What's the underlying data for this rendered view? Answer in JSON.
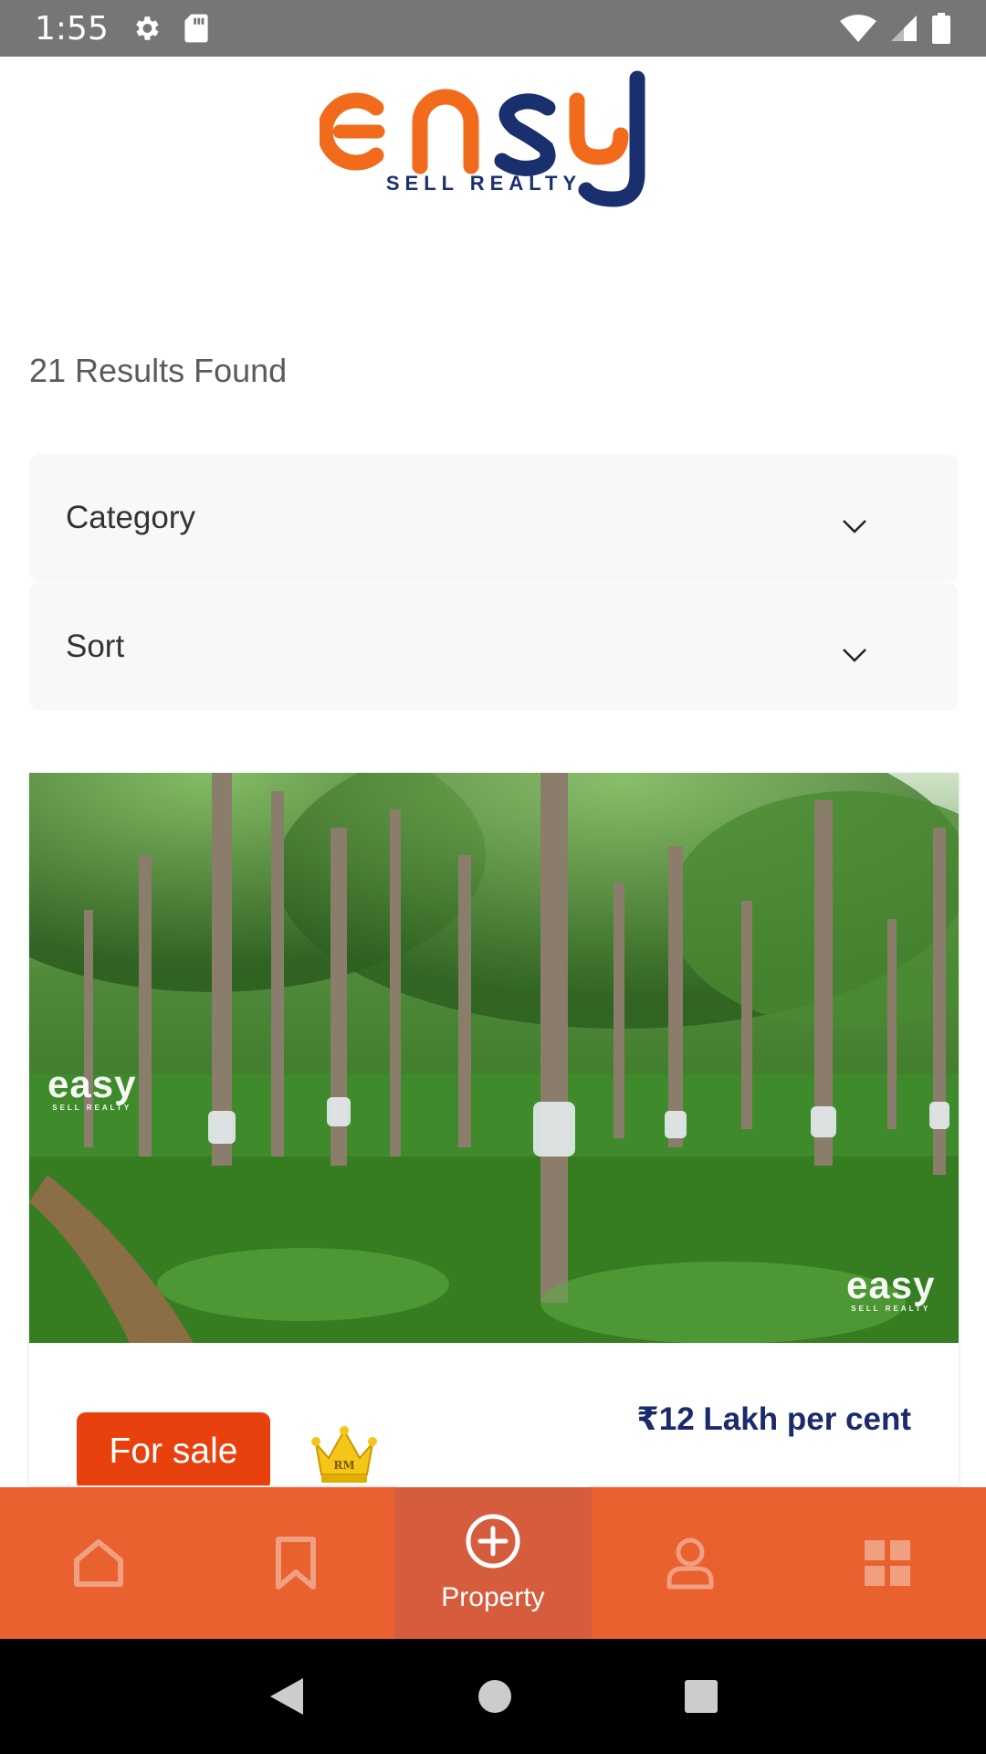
{
  "status_bar": {
    "time": "1:55",
    "left_icons": [
      "gear-icon",
      "sd-card-icon"
    ],
    "right_icons": [
      "wifi-icon",
      "signal-icon",
      "battery-icon"
    ]
  },
  "logo": {
    "main": "easy",
    "sub": "SELL REALTY",
    "colors": {
      "orange": "#F26A1B",
      "navy": "#1A2F6E"
    }
  },
  "results": {
    "count_text": "21 Results Found"
  },
  "filters": {
    "category_label": "Category",
    "sort_label": "Sort"
  },
  "listing": {
    "image_icon": "rubber-plantation-photo",
    "watermark_main": "easy",
    "watermark_sub": "SELL REALTY",
    "price": "₹12 Lakh per cent",
    "status_badge": "For sale",
    "crown_text": "RM",
    "colors": {
      "badge": "#E8410D",
      "price": "#1A2A6C"
    }
  },
  "bottom_nav": {
    "items": [
      {
        "icon": "home-icon",
        "label": ""
      },
      {
        "icon": "bookmark-icon",
        "label": ""
      },
      {
        "icon": "plus-circle-icon",
        "label": "Property",
        "active": true
      },
      {
        "icon": "user-icon",
        "label": ""
      },
      {
        "icon": "grid-icon",
        "label": ""
      }
    ],
    "colors": {
      "background": "#E8612F",
      "active": "#D55D3D"
    }
  },
  "system_nav": {
    "icons": [
      "back-icon",
      "home-circle-icon",
      "recents-icon"
    ]
  }
}
